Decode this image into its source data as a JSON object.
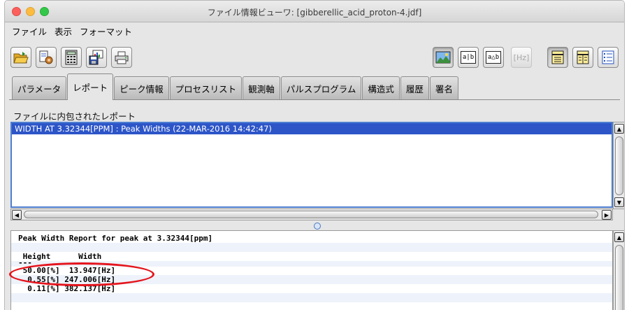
{
  "window": {
    "title": "ファイル情報ビューワ: [gibberellic_acid_proton-4.jdf]"
  },
  "menubar": [
    "ファイル",
    "表示",
    "フォーマット"
  ],
  "toolbar": {
    "left_icons": [
      "open-folder-icon",
      "properties-icon",
      "calculator-icon",
      "save-disk-icon",
      "print-icon"
    ],
    "right_buttons": [
      {
        "name": "image-view",
        "label": ""
      },
      {
        "name": "text-ab",
        "label": "a|b"
      },
      {
        "name": "delta-ab",
        "label": "a△b"
      },
      {
        "name": "hz-unit",
        "label": "[Hz]"
      },
      {
        "name": "layout-1",
        "label": ""
      },
      {
        "name": "layout-2",
        "label": ""
      },
      {
        "name": "list-view",
        "label": ""
      }
    ]
  },
  "tabs": [
    {
      "label": "パラメータ",
      "active": false
    },
    {
      "label": "レポート",
      "active": true
    },
    {
      "label": "ピーク情報",
      "active": false
    },
    {
      "label": "プロセスリスト",
      "active": false
    },
    {
      "label": "観測軸",
      "active": false
    },
    {
      "label": "パルスプログラム",
      "active": false
    },
    {
      "label": "構造式",
      "active": false
    },
    {
      "label": "履歴",
      "active": false
    },
    {
      "label": "署名",
      "active": false
    }
  ],
  "report_section": {
    "label": "ファイルに内包されたレポート",
    "items": [
      "WIDTH AT 3.32344[PPM] : Peak Widths  (22-MAR-2016 14:42:47)"
    ]
  },
  "report_detail": {
    "heading": "Peak Width Report for peak at 3.32344[ppm]",
    "header_row": " Height      Width",
    "divider": "---",
    "rows": [
      " 50.00[%]  13.947[Hz]",
      "  0.55[%] 247.006[Hz]",
      "  0.11[%] 382.137[Hz]"
    ]
  },
  "colors": {
    "selection": "#2d55c8",
    "annotation": "#e5141c"
  }
}
